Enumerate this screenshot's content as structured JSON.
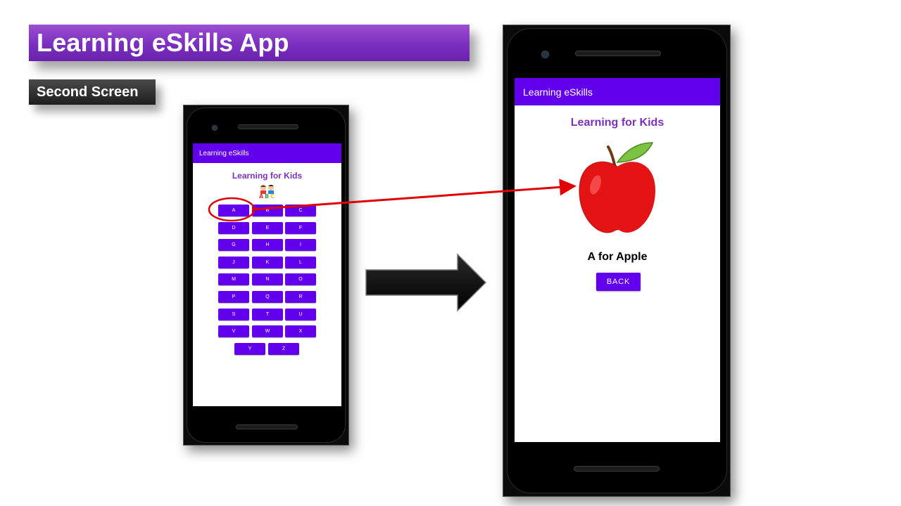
{
  "slide": {
    "title": "Learning eSkills App",
    "subtitle": "Second Screen"
  },
  "first_screen": {
    "app_title": "Learning eSkills",
    "heading": "Learning for Kids",
    "logo_icon": "kids-abc-icon",
    "letters": [
      "A",
      "B",
      "C",
      "D",
      "E",
      "F",
      "G",
      "H",
      "I",
      "J",
      "K",
      "L",
      "M",
      "N",
      "O",
      "P",
      "Q",
      "R",
      "S",
      "T",
      "U",
      "V",
      "W",
      "X",
      "Y",
      "Z"
    ]
  },
  "second_screen": {
    "app_title": "Learning eSkills",
    "heading": "Learning for Kids",
    "image_icon": "apple-icon",
    "caption": "A for Apple",
    "back_label": "BACK"
  },
  "colors": {
    "app_bar": "#6200ee",
    "heading": "#7b2fbf",
    "highlight": "#e00000"
  }
}
